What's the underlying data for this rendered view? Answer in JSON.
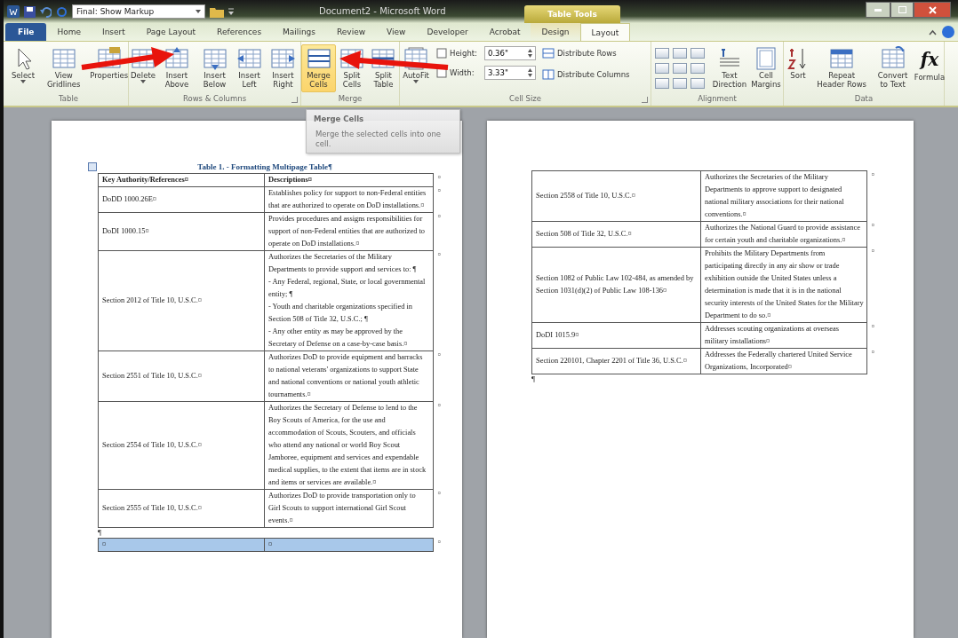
{
  "title_bar": {
    "markup_dropdown": "Final: Show Markup",
    "title": "Document2 - Microsoft Word",
    "context_group": "Table Tools"
  },
  "tabs": [
    {
      "label": "File",
      "kind": "file",
      "selected": false,
      "contextual": false
    },
    {
      "label": "Home",
      "kind": "tab",
      "selected": false,
      "contextual": false
    },
    {
      "label": "Insert",
      "kind": "tab",
      "selected": false,
      "contextual": false
    },
    {
      "label": "Page Layout",
      "kind": "tab",
      "selected": false,
      "contextual": false
    },
    {
      "label": "References",
      "kind": "tab",
      "selected": false,
      "contextual": false
    },
    {
      "label": "Mailings",
      "kind": "tab",
      "selected": false,
      "contextual": false
    },
    {
      "label": "Review",
      "kind": "tab",
      "selected": false,
      "contextual": false
    },
    {
      "label": "View",
      "kind": "tab",
      "selected": false,
      "contextual": false
    },
    {
      "label": "Developer",
      "kind": "tab",
      "selected": false,
      "contextual": false
    },
    {
      "label": "Acrobat",
      "kind": "tab",
      "selected": false,
      "contextual": false
    },
    {
      "label": "Design",
      "kind": "tab",
      "selected": false,
      "contextual": true
    },
    {
      "label": "Layout",
      "kind": "tab",
      "selected": true,
      "contextual": true
    }
  ],
  "ribbon_groups": [
    {
      "label": "Table",
      "items": [
        {
          "kind": "large",
          "label": "Select",
          "dropdown": true,
          "highlighted": false
        },
        {
          "kind": "large",
          "label": "View Gridlines",
          "dropdown": false,
          "highlighted": false
        },
        {
          "kind": "large",
          "label": "Properties",
          "dropdown": false,
          "highlighted": false
        }
      ]
    },
    {
      "label": "Rows & Columns",
      "launcher": true,
      "items": [
        {
          "kind": "large",
          "label": "Delete",
          "dropdown": true,
          "highlighted": false
        },
        {
          "kind": "large",
          "label": "Insert Above",
          "dropdown": false,
          "highlighted": false
        },
        {
          "kind": "large",
          "label": "Insert Below",
          "dropdown": false,
          "highlighted": false
        },
        {
          "kind": "large",
          "label": "Insert Left",
          "dropdown": false,
          "highlighted": false
        },
        {
          "kind": "large",
          "label": "Insert Right",
          "dropdown": false,
          "highlighted": false
        }
      ]
    },
    {
      "label": "Merge",
      "items": [
        {
          "kind": "large",
          "label": "Merge Cells",
          "dropdown": false,
          "highlighted": true
        },
        {
          "kind": "large",
          "label": "Split Cells",
          "dropdown": false,
          "highlighted": false
        },
        {
          "kind": "large",
          "label": "Split Table",
          "dropdown": false,
          "highlighted": false
        }
      ]
    },
    {
      "label": "Cell Size",
      "launcher": true,
      "items": [
        {
          "kind": "large",
          "label": "AutoFit",
          "dropdown": true,
          "highlighted": false
        },
        {
          "kind": "fields",
          "fields": [
            {
              "label": "Height:",
              "value": "0.36\""
            },
            {
              "label": "Width:",
              "value": "3.33\""
            }
          ]
        },
        {
          "kind": "small",
          "labels": [
            "Distribute Rows",
            "Distribute Columns"
          ]
        }
      ]
    },
    {
      "label": "Alignment",
      "items": [
        {
          "kind": "align"
        },
        {
          "kind": "large",
          "label": "Text Direction",
          "dropdown": false,
          "highlighted": false
        },
        {
          "kind": "large",
          "label": "Cell Margins",
          "dropdown": false,
          "highlighted": false
        }
      ]
    },
    {
      "label": "Data",
      "items": [
        {
          "kind": "large",
          "label": "Sort",
          "dropdown": false,
          "highlighted": false
        },
        {
          "kind": "large",
          "label": "Repeat Header Rows",
          "dropdown": false,
          "highlighted": false
        },
        {
          "kind": "large",
          "label": "Convert to Text",
          "dropdown": false,
          "highlighted": false
        },
        {
          "kind": "large",
          "label": "Formula",
          "glyph": "fx",
          "dropdown": false,
          "highlighted": false
        }
      ]
    }
  ],
  "tooltip": {
    "title": "Merge Cells",
    "text": "Merge the selected cells into one cell."
  },
  "left_page": {
    "caption": "Table 1. - Formatting Multipage Table¶",
    "header": {
      "ref": "Key Authority/References¤",
      "desc": "Descriptions¤",
      "end_mark": "¤"
    },
    "rows": [
      {
        "ref": "DoDD 1000.26E¤",
        "desc": [
          "Establishes policy for support to non-Federal entities that are authorized to operate on DoD installations.¤"
        ],
        "end_mark": "¤"
      },
      {
        "ref": "DoDI 1000.15¤",
        "desc": [
          "Provides procedures and assigns responsibilities for support of non-Federal entities that are authorized to operate on DoD installations.¤"
        ],
        "end_mark": "¤"
      },
      {
        "ref": "Section 2012 of Title 10, U.S.C.¤",
        "desc": [
          "Authorizes the Secretaries of the Military Departments to provide support and services to: ¶",
          "- Any Federal, regional, State, or local governmental entity; ¶",
          "- Youth and charitable organizations specified in Section 508 of Title 32, U.S.C.; ¶",
          "- Any other entity as may be approved by the Secretary of Defense on a case-by-case basis.¤"
        ],
        "end_mark": "¤"
      },
      {
        "ref": "Section 2551 of Title 10, U.S.C.¤",
        "desc": [
          "Authorizes DoD to provide equipment and barracks to national veterans' organizations to support State and national conventions or national youth athletic tournaments.¤"
        ],
        "end_mark": "¤"
      },
      {
        "ref": "Section 2554 of Title 10, U.S.C.¤",
        "desc": [
          "Authorizes the Secretary of Defense to lend to the Boy Scouts of America, for the use and accommodation of Scouts, Scouters, and officials who attend any national or world Boy Scout Jamboree, equipment and services and expendable medical supplies, to the extent that items are in stock and items or services are available.¤"
        ],
        "end_mark": "¤"
      },
      {
        "ref": "Section 2555 of Title 10, U.S.C.¤",
        "desc": [
          "Authorizes DoD to provide transportation only to Girl Scouts to support international Girl Scout events.¤"
        ],
        "end_mark": "¤"
      }
    ],
    "after_table": "¶",
    "extra_row": {
      "cells": [
        "¤",
        "¤"
      ],
      "end_mark": "¤",
      "selected": true
    }
  },
  "right_page": {
    "rows": [
      {
        "ref": "Section 2558 of Title 10, U.S.C.¤",
        "desc": [
          "Authorizes the Secretaries of the Military Departments to approve support to designated national military associations for their national conventions.¤"
        ],
        "end_mark": "¤"
      },
      {
        "ref": "Section 508 of Title 32, U.S.C.¤",
        "desc": [
          "Authorizes the National Guard to provide assistance for certain youth and charitable organizations.¤"
        ],
        "end_mark": "¤"
      },
      {
        "ref": "Section 1082 of Public Law 102-484, as amended by Section 1031(d)(2) of Public Law 108-136¤",
        "desc": [
          "Prohibits the Military Departments from participating directly in any air show or trade exhibition outside the United States unless a determination is made that it is in the national security interests of the United States for the Military Department to do so.¤"
        ],
        "end_mark": "¤"
      },
      {
        "ref": "DoDI 1015.9¤",
        "desc": [
          "Addresses scouting organizations at overseas military installations¤"
        ],
        "end_mark": "¤"
      },
      {
        "ref": "Section 220101, Chapter 2201 of Title 36, U.S.C.¤",
        "desc": [
          "Addresses the Federally chartered United Service Organizations, Incorporated¤"
        ],
        "end_mark": "¤"
      }
    ],
    "after_table": "¶"
  }
}
